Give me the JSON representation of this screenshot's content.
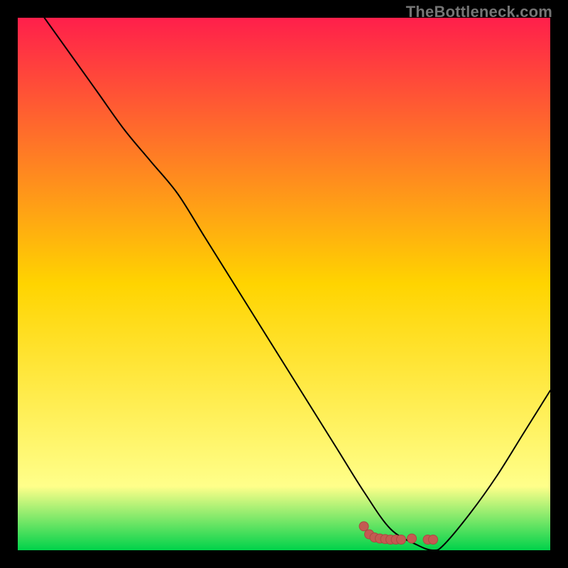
{
  "watermark": "TheBottleneck.com",
  "colors": {
    "page_bg": "#000000",
    "gradient_top": "#ff1f4b",
    "gradient_mid": "#ffd400",
    "gradient_low": "#ffff8a",
    "gradient_bottom": "#00d24a",
    "curve": "#000000",
    "marker_fill": "#c45a52",
    "marker_stroke": "#aa4943"
  },
  "chart_data": {
    "type": "line",
    "title": "",
    "xlabel": "",
    "ylabel": "",
    "xlim": [
      0,
      100
    ],
    "ylim": [
      0,
      100
    ],
    "grid": false,
    "legend": false,
    "series": [
      {
        "name": "bottleneck-curve",
        "x": [
          5,
          10,
          15,
          20,
          25,
          30,
          35,
          40,
          45,
          50,
          55,
          60,
          65,
          70,
          75,
          78,
          80,
          85,
          90,
          95,
          100
        ],
        "y": [
          100,
          93,
          86,
          79,
          73,
          67,
          59,
          51,
          43,
          35,
          27,
          19,
          11,
          4,
          1,
          0,
          1,
          7,
          14,
          22,
          30
        ]
      }
    ],
    "markers": [
      {
        "x": 65,
        "y": 4.5
      },
      {
        "x": 66,
        "y": 3.0
      },
      {
        "x": 67,
        "y": 2.4
      },
      {
        "x": 68,
        "y": 2.2
      },
      {
        "x": 69,
        "y": 2.1
      },
      {
        "x": 70,
        "y": 2.0
      },
      {
        "x": 71,
        "y": 2.0
      },
      {
        "x": 72,
        "y": 2.0
      },
      {
        "x": 74,
        "y": 2.2
      },
      {
        "x": 77,
        "y": 2.0
      },
      {
        "x": 78,
        "y": 2.0
      }
    ],
    "background": {
      "type": "vertical-gradient",
      "stops": [
        {
          "offset": 0,
          "value": 100,
          "color": "#ff1f4b"
        },
        {
          "offset": 50,
          "value": 50,
          "color": "#ffd400"
        },
        {
          "offset": 88,
          "value": 12,
          "color": "#ffff8a"
        },
        {
          "offset": 100,
          "value": 0,
          "color": "#00d24a"
        }
      ]
    }
  }
}
